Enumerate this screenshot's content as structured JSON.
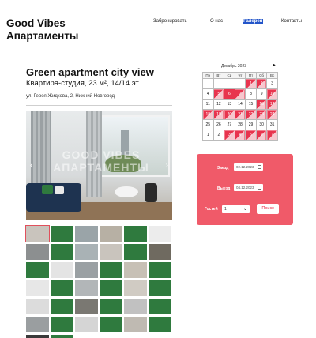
{
  "header": {
    "logo": "Good Vibes Апартаменты",
    "nav": [
      {
        "label": "Забронировать"
      },
      {
        "label": "О нас"
      },
      {
        "label": "Галерея"
      },
      {
        "label": "Контакты"
      }
    ]
  },
  "listing": {
    "title": "Green apartment city view",
    "subtitle": "Квартира-студия, 23 м², 14/14 эт.",
    "address": "ул. Героя Жидкова, 2, Нижний Новгород",
    "photo_prev": "‹",
    "photo_next": "›",
    "watermark": "GOOD VIBES АПАРТАМЕНТЫ"
  },
  "calendar": {
    "month": "Декабрь 2023",
    "next": "►",
    "weekdays": [
      "Пн",
      "Вт",
      "Ср",
      "Чт",
      "Пт",
      "Сб",
      "Вс"
    ],
    "weeks": [
      [
        {
          "d": "",
          "s": ""
        },
        {
          "d": "",
          "s": ""
        },
        {
          "d": "",
          "s": ""
        },
        {
          "d": "",
          "s": ""
        },
        {
          "d": "1",
          "s": "busy"
        },
        {
          "d": "2",
          "s": "busy"
        },
        {
          "d": "3",
          "s": ""
        }
      ],
      [
        {
          "d": "4",
          "s": ""
        },
        {
          "d": "5",
          "s": "busy"
        },
        {
          "d": "6",
          "s": "full"
        },
        {
          "d": "7",
          "s": "busy"
        },
        {
          "d": "8",
          "s": ""
        },
        {
          "d": "9",
          "s": ""
        },
        {
          "d": "10",
          "s": "busy"
        }
      ],
      [
        {
          "d": "11",
          "s": ""
        },
        {
          "d": "12",
          "s": ""
        },
        {
          "d": "13",
          "s": ""
        },
        {
          "d": "14",
          "s": ""
        },
        {
          "d": "15",
          "s": ""
        },
        {
          "d": "16",
          "s": "busy"
        },
        {
          "d": "17",
          "s": "busy"
        }
      ],
      [
        {
          "d": "18",
          "s": "busy"
        },
        {
          "d": "19",
          "s": "busy"
        },
        {
          "d": "20",
          "s": "busy"
        },
        {
          "d": "21",
          "s": "busy"
        },
        {
          "d": "22",
          "s": "busy"
        },
        {
          "d": "23",
          "s": "busy"
        },
        {
          "d": "24",
          "s": "busy"
        }
      ],
      [
        {
          "d": "25",
          "s": ""
        },
        {
          "d": "26",
          "s": ""
        },
        {
          "d": "27",
          "s": ""
        },
        {
          "d": "28",
          "s": ""
        },
        {
          "d": "29",
          "s": ""
        },
        {
          "d": "30",
          "s": ""
        },
        {
          "d": "31",
          "s": ""
        }
      ],
      [
        {
          "d": "1",
          "s": ""
        },
        {
          "d": "2",
          "s": ""
        },
        {
          "d": "3",
          "s": "busy"
        },
        {
          "d": "4",
          "s": "busy"
        },
        {
          "d": "5",
          "s": "busy"
        },
        {
          "d": "6",
          "s": "busy"
        },
        {
          "d": "7",
          "s": "busy"
        }
      ]
    ]
  },
  "booking": {
    "checkin_label": "Заезд",
    "checkin_value": "02.12.2023",
    "checkout_label": "Выезд",
    "checkout_value": "04.12.2023",
    "guests_label": "Гостей",
    "guests_value": "1",
    "search_label": "Поиск"
  },
  "colors": {
    "accent": "#f05a69",
    "busy": "#e8344e",
    "nav_active": "#2355c9"
  },
  "thumbnails": [
    "#c9c4bd",
    "#2f7a3e",
    "#9aa4a8",
    "#b7b0a4",
    "#2f7a3e",
    "#ececec",
    "#8c8f90",
    "#2f7a3e",
    "#a9b2b5",
    "#c9c4bd",
    "#2f7a3e",
    "#6f6a60",
    "#2f7a3e",
    "#e4e4e4",
    "#9aa0a3",
    "#2f7a3e",
    "#c7c0b5",
    "#2f7a3e",
    "#e7e7e7",
    "#2f7a3e",
    "#b2b6b8",
    "#2f7a3e",
    "#d0cbc3",
    "#2f7a3e",
    "#dcdcdc",
    "#2f7a3e",
    "#7a7872",
    "#2f7a3e",
    "#c1c1c1",
    "#2f7a3e",
    "#9a9ea0",
    "#2f7a3e",
    "#d5d5d5",
    "#2f7a3e",
    "#bfbab2",
    "#2f7a3e",
    "#3a3a3a",
    "#2f7a3e"
  ]
}
